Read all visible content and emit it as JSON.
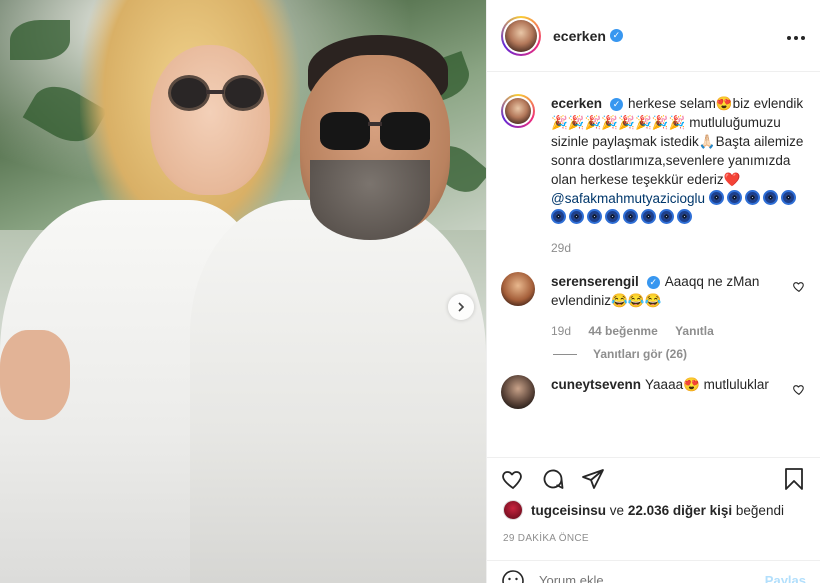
{
  "header": {
    "username": "ecerken",
    "more_icon": "more-horizontal-icon",
    "verified": true
  },
  "caption": {
    "username": "ecerken",
    "text_1": "herkese selam😍biz evlendik🎉🎉🎉🎉🎉🎉🎉🎉 mutluluğumuzu sizinle paylaşmak istedik🙏🏻Başta ailemize sonra dostlarımıza,sevenlere yanımızda olan herkese teşekkür ederiz❤️",
    "mention": "@safakmahmutyazicioglu",
    "evil_eye_count": 13,
    "age": "29d"
  },
  "comments": [
    {
      "username": "serenserengil",
      "verified": true,
      "text": "Aaaqq ne zMan evlendiniz😂😂😂",
      "age": "19d",
      "likes": "44 beğenme",
      "reply": "Yanıtla",
      "view_replies": "Yanıtları gör (26)"
    },
    {
      "username": "cuneytsevenn",
      "verified": false,
      "text": "Yaaaa😍 mutluluklar"
    }
  ],
  "likes": {
    "liker": "tugceisinsu",
    "connector": "ve",
    "others": "22.036 diğer kişi",
    "suffix": "beğendi"
  },
  "timestamp": "29 DAKİKA ÖNCE",
  "add_comment": {
    "placeholder": "Yorum ekle...",
    "post_label": "Paylaş"
  },
  "colors": {
    "verified": "#3897f0",
    "link": "#00376b",
    "muted": "#8e8e8e",
    "text": "#262626"
  },
  "icons": [
    "heart-icon",
    "comment-icon",
    "share-icon",
    "bookmark-icon",
    "emoji-icon",
    "chevron-right-icon"
  ]
}
